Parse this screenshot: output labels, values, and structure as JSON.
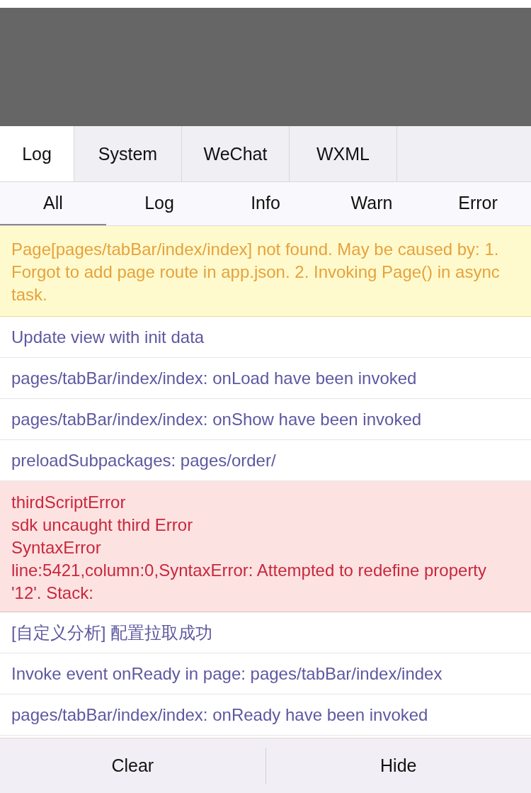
{
  "tabs": [
    {
      "label": "Log",
      "selected": true
    },
    {
      "label": "System",
      "selected": false
    },
    {
      "label": "WeChat",
      "selected": false
    },
    {
      "label": "WXML",
      "selected": false
    }
  ],
  "filters": [
    {
      "label": "All",
      "selected": true
    },
    {
      "label": "Log",
      "selected": false
    },
    {
      "label": "Info",
      "selected": false
    },
    {
      "label": "Warn",
      "selected": false
    },
    {
      "label": "Error",
      "selected": false
    }
  ],
  "logs": [
    {
      "kind": "warn",
      "lines": [
        "Page[pages/tabBar/index/index] not found. May be caused by: 1. Forgot to add page route in app.json. 2. Invoking Page() in async task."
      ]
    },
    {
      "kind": "log",
      "lines": [
        "Update view with init data"
      ]
    },
    {
      "kind": "log",
      "lines": [
        "pages/tabBar/index/index: onLoad have been invoked"
      ]
    },
    {
      "kind": "log",
      "lines": [
        "pages/tabBar/index/index: onShow have been invoked"
      ]
    },
    {
      "kind": "log",
      "lines": [
        "preloadSubpackages: pages/order/"
      ]
    },
    {
      "kind": "error",
      "lines": [
        "thirdScriptError",
        "sdk uncaught third Error",
        "SyntaxError",
        "line:5421,column:0,SyntaxError: Attempted to redefine property '12'. Stack:"
      ]
    },
    {
      "kind": "log",
      "lines": [
        "[自定义分析] 配置拉取成功"
      ]
    },
    {
      "kind": "log",
      "lines": [
        "Invoke event onReady in page: pages/tabBar/index/index"
      ]
    },
    {
      "kind": "log",
      "lines": [
        "pages/tabBar/index/index: onReady have been invoked"
      ]
    }
  ],
  "buttons": [
    "Clear",
    "Hide"
  ]
}
